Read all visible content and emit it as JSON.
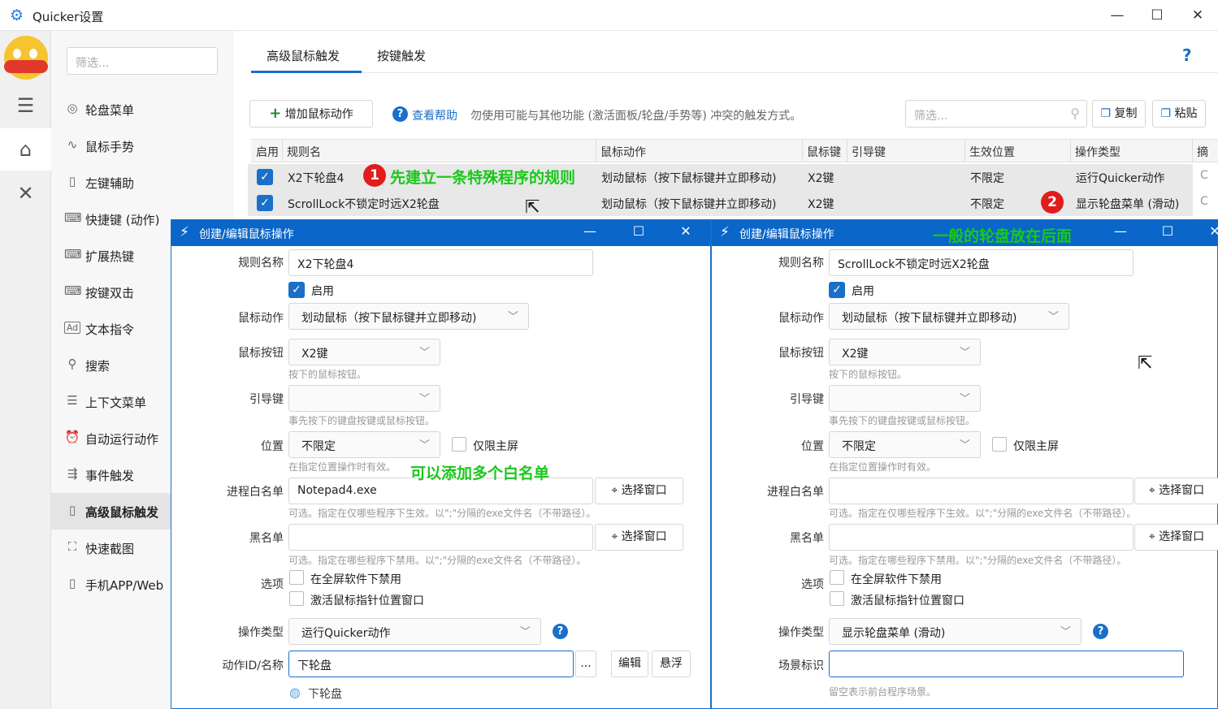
{
  "window": {
    "title": "Quicker设置",
    "minimize": "—",
    "maximize": "☐",
    "close": "✕"
  },
  "rail": {
    "items": [
      "avatar-icon",
      "sliders-icon",
      "shapes-icon",
      "tools-icon"
    ]
  },
  "nav": {
    "filter_placeholder": "筛选...",
    "items": [
      {
        "label": "轮盘菜单",
        "icon": "◎"
      },
      {
        "label": "鼠标手势",
        "icon": "∿"
      },
      {
        "label": "左键辅助",
        "icon": "▯"
      },
      {
        "label": "快捷键 (动作)",
        "icon": "⌨"
      },
      {
        "label": "扩展热键",
        "icon": "⌨"
      },
      {
        "label": "按键双击",
        "icon": "⌨"
      },
      {
        "label": "文本指令",
        "icon": "Ad"
      },
      {
        "label": "搜索",
        "icon": "⚲"
      },
      {
        "label": "上下文菜单",
        "icon": "☰"
      },
      {
        "label": "自动运行动作",
        "icon": "⏰"
      },
      {
        "label": "事件触发",
        "icon": "⇶"
      },
      {
        "label": "高级鼠标触发",
        "icon": "▯"
      },
      {
        "label": "快速截图",
        "icon": "⛶"
      },
      {
        "label": "手机APP/Web",
        "icon": "▯"
      }
    ]
  },
  "tabs": {
    "tab1": "高级鼠标触发",
    "tab2": "按键触发",
    "help": "?"
  },
  "toolbar": {
    "add_label": "增加鼠标动作",
    "help_link": "查看帮助",
    "hint": "勿使用可能与其他功能 (激活面板/轮盘/手势等) 冲突的触发方式。",
    "filter_placeholder": "筛选...",
    "copy_label": "复制",
    "paste_label": "粘贴"
  },
  "grid": {
    "headers": [
      "启用",
      "规则名",
      "鼠标动作",
      "鼠标键",
      "引导键",
      "生效位置",
      "操作类型",
      "摘"
    ],
    "rows": [
      {
        "name": "X2下轮盘4",
        "action": "划动鼠标（按下鼠标键并立即移动)",
        "button": "X2键",
        "guide": "",
        "position": "不限定",
        "op": "运行Quicker动作",
        "extra": "C"
      },
      {
        "name": "ScrollLock不锁定时远X2轮盘",
        "action": "划动鼠标（按下鼠标键并立即移动)",
        "button": "X2键",
        "guide": "",
        "position": "不限定",
        "op": "显示轮盘菜单 (滑动)",
        "extra": "C"
      }
    ]
  },
  "annotations": {
    "badge1": "1",
    "badge2": "2",
    "note1": "先建立一条特殊程序的规则",
    "note2": "一般的轮盘放在后面",
    "note3": "可以添加多个白名单"
  },
  "dialog_left": {
    "title": "创建/编辑鼠标操作",
    "rule_name_label": "规则名称",
    "rule_name": "X2下轮盘4",
    "enabled_label": "启用",
    "mouse_action_label": "鼠标动作",
    "mouse_action": "划动鼠标（按下鼠标键并立即移动)",
    "mouse_button_label": "鼠标按钮",
    "mouse_button": "X2键",
    "mouse_button_hint": "按下的鼠标按钮。",
    "guide_key_label": "引导键",
    "guide_key_hint": "事先按下的键盘按键或鼠标按钮。",
    "position_label": "位置",
    "position": "不限定",
    "main_screen_label": "仅限主屏",
    "position_hint": "在指定位置操作时有效。",
    "whitelist_label": "进程白名单",
    "whitelist": "Notepad4.exe",
    "select_window": "选择窗口",
    "whitelist_hint": "可选。指定在仅哪些程序下生效。以\";\"分隔的exe文件名（不带路径）。",
    "blacklist_label": "黑名单",
    "blacklist_hint": "可选。指定在哪些程序下禁用。以\";\"分隔的exe文件名（不带路径）。",
    "options_label": "选项",
    "opt_fullscreen": "在全屏软件下禁用",
    "opt_activate": "激活鼠标指针位置窗口",
    "op_type_label": "操作类型",
    "op_type": "运行Quicker动作",
    "action_id_label": "动作ID/名称",
    "action_id": "下轮盘",
    "dots": "...",
    "edit": "编辑",
    "float": "悬浮",
    "action_preview": "下轮盘"
  },
  "dialog_right": {
    "title": "创建/编辑鼠标操作",
    "rule_name_label": "规则名称",
    "rule_name": "ScrollLock不锁定时远X2轮盘",
    "enabled_label": "启用",
    "mouse_action_label": "鼠标动作",
    "mouse_action": "划动鼠标（按下鼠标键并立即移动)",
    "mouse_button_label": "鼠标按钮",
    "mouse_button": "X2键",
    "mouse_button_hint": "按下的鼠标按钮。",
    "guide_key_label": "引导键",
    "guide_key_hint": "事先按下的键盘按键或鼠标按钮。",
    "position_label": "位置",
    "position": "不限定",
    "main_screen_label": "仅限主屏",
    "position_hint": "在指定位置操作时有效。",
    "whitelist_label": "进程白名单",
    "select_window": "选择窗口",
    "whitelist_hint": "可选。指定在仅哪些程序下生效。以\";\"分隔的exe文件名（不带路径）。",
    "blacklist_label": "黑名单",
    "blacklist_hint": "可选。指定在哪些程序下禁用。以\";\"分隔的exe文件名（不带路径）。",
    "options_label": "选项",
    "opt_fullscreen": "在全屏软件下禁用",
    "opt_activate": "激活鼠标指针位置窗口",
    "op_type_label": "操作类型",
    "op_type": "显示轮盘菜单 (滑动)",
    "scene_label": "场景标识",
    "scene_hint": "留空表示前台程序场景。"
  },
  "colors": {
    "accent": "#1a6fc9",
    "dialog_bar": "#0a66c8",
    "annotation_green": "#19c819",
    "badge_red": "#e21b1b"
  }
}
